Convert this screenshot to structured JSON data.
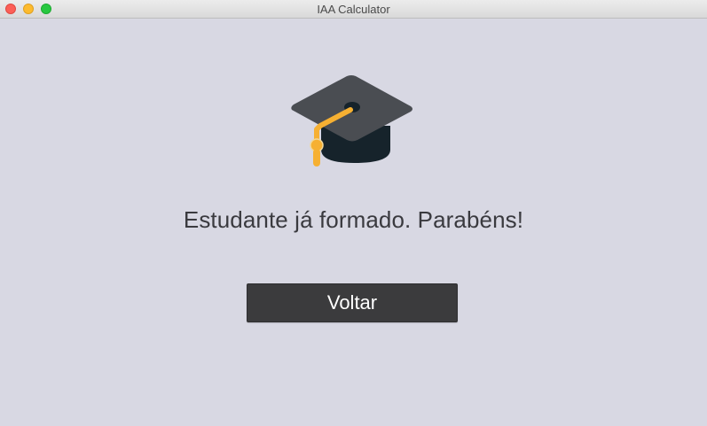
{
  "window": {
    "title": "IAA Calculator"
  },
  "main": {
    "icon": "graduation-cap-icon",
    "message": "Estudante já formado. Parabéns!",
    "back_button_label": "Voltar"
  },
  "colors": {
    "background": "#d8d8e3",
    "button_background": "#3b3b3d",
    "button_text": "#ffffff",
    "cap_top": "#4a4d52",
    "cap_base": "#16232b",
    "tassel": "#f6b032"
  }
}
